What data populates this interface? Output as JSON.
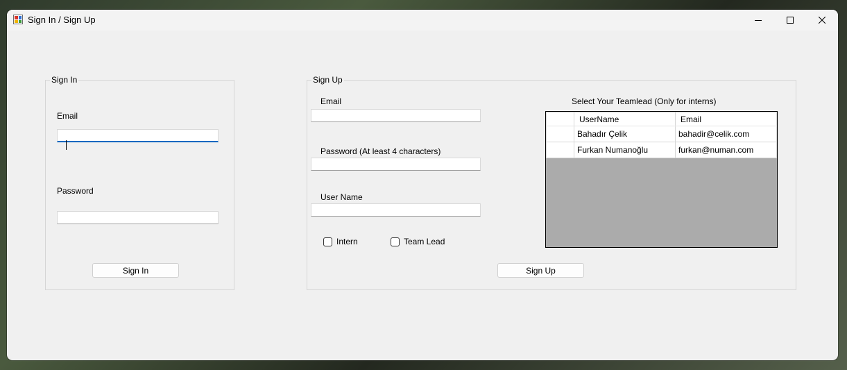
{
  "window": {
    "title": "Sign In / Sign Up"
  },
  "signin": {
    "group_title": "Sign In",
    "email_label": "Email",
    "email_value": "",
    "password_label": "Password",
    "password_value": "",
    "button_label": "Sign In"
  },
  "signup": {
    "group_title": "Sign Up",
    "email_label": "Email",
    "email_value": "",
    "password_label": "Password (At least 4 characters)",
    "password_value": "",
    "username_label": "User Name",
    "username_value": "",
    "intern_label": "Intern",
    "intern_checked": false,
    "teamlead_label": "Team Lead",
    "teamlead_checked": false,
    "teamlead_grid_label": "Select Your Teamlead (Only for interns)",
    "button_label": "Sign Up",
    "grid": {
      "columns": [
        "UserName",
        "Email"
      ],
      "rows": [
        {
          "username": "Bahadır Çelik",
          "email": "bahadir@celik.com"
        },
        {
          "username": "Furkan Numanoğlu",
          "email": "furkan@numan.com"
        }
      ]
    }
  },
  "icons": {
    "app": "app-form-icon",
    "minimize": "minimize-icon",
    "maximize": "maximize-icon",
    "close": "close-icon"
  }
}
